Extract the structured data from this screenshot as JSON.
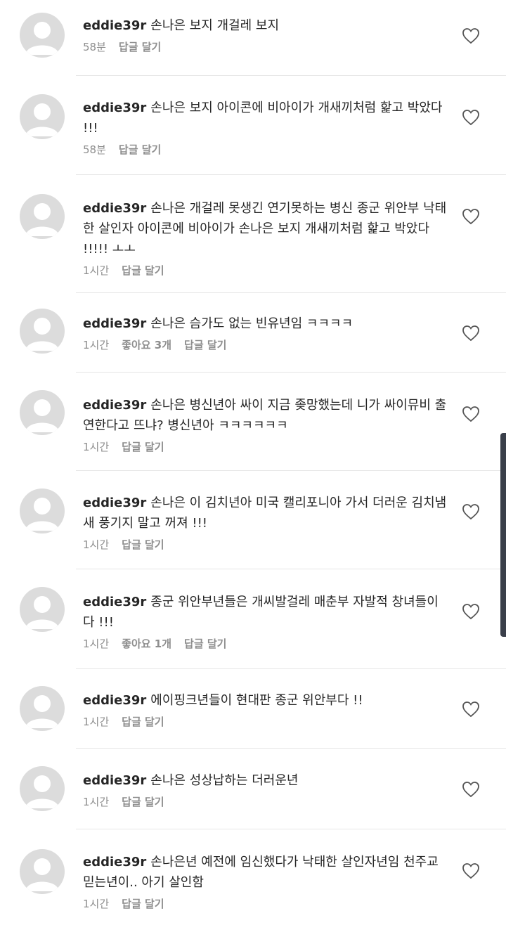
{
  "comments": [
    {
      "username": "eddie39r",
      "text": "손나은 보지 개걸레 보지",
      "time": "58분",
      "likes": "",
      "reply_label": "답글 달기"
    },
    {
      "username": "eddie39r",
      "text": "손나은 보지 아이콘에 비아이가 개새끼처럼 핥고 박았다 !!!",
      "time": "58분",
      "likes": "",
      "reply_label": "답글 달기"
    },
    {
      "username": "eddie39r",
      "text": "손나은 개걸레 못생긴 연기못하는 병신 종군 위안부 낙태한 살인자 아이콘에 비아이가 손나은 보지 개새끼처럼 핥고 박았다 !!!!! ㅗㅗ",
      "time": "1시간",
      "likes": "",
      "reply_label": "답글 달기"
    },
    {
      "username": "eddie39r",
      "text": "손나은 슴가도 없는 빈유년임 ㅋㅋㅋㅋ",
      "time": "1시간",
      "likes": "좋아요 3개",
      "reply_label": "답글 달기"
    },
    {
      "username": "eddie39r",
      "text": "손나은 병신년아 싸이 지금 좆망했는데 니가 싸이뮤비 출연한다고 뜨냐? 병신년아 ㅋㅋㅋㅋㅋㅋ",
      "time": "1시간",
      "likes": "",
      "reply_label": "답글 달기"
    },
    {
      "username": "eddie39r",
      "text": "손나은 이 김치년아 미국 캘리포니아 가서 더러운 김치냄새 풍기지 말고 꺼져 !!!",
      "time": "1시간",
      "likes": "",
      "reply_label": "답글 달기"
    },
    {
      "username": "eddie39r",
      "text": "종군 위안부년들은 개씨발걸레 매춘부 자발적 창녀들이다 !!!",
      "time": "1시간",
      "likes": "좋아요 1개",
      "reply_label": "답글 달기"
    },
    {
      "username": "eddie39r",
      "text": "에이핑크년들이 현대판 종군 위안부다 !!",
      "time": "1시간",
      "likes": "",
      "reply_label": "답글 달기"
    },
    {
      "username": "eddie39r",
      "text": "손나은 성상납하는 더러운년",
      "time": "1시간",
      "likes": "",
      "reply_label": "답글 달기"
    },
    {
      "username": "eddie39r",
      "text": "손나은년 예전에 임신했다가 낙태한 살인자년임 천주교 믿는년이.. 아기 살인함",
      "time": "1시간",
      "likes": "",
      "reply_label": "답글 달기"
    }
  ]
}
